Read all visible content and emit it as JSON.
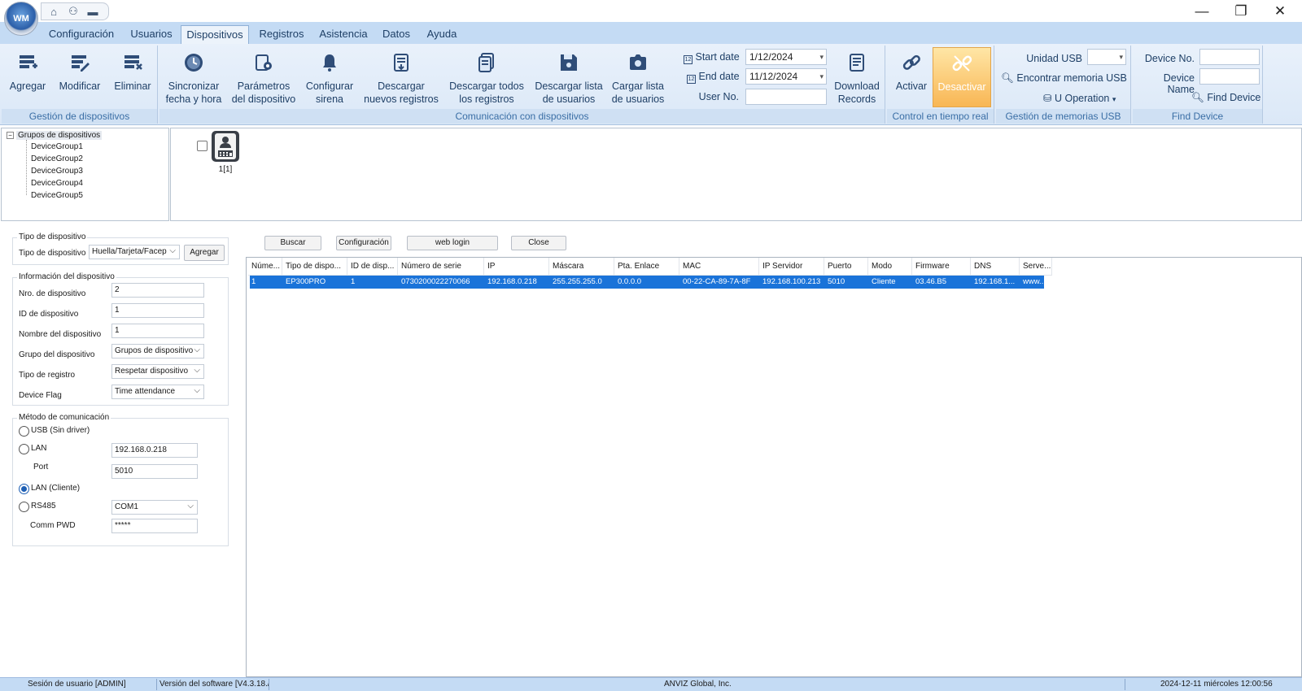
{
  "window": {
    "minimize": "—",
    "restore": "❐",
    "close": "✕"
  },
  "menu_tabs": [
    "Configuración",
    "Usuarios",
    "Dispositivos",
    "Registros",
    "Asistencia",
    "Datos",
    "Ayuda"
  ],
  "active_tab": "Dispositivos",
  "ribbon": {
    "gestion": {
      "label": "Gestión de dispositivos",
      "agregar": "Agregar",
      "modificar": "Modificar",
      "eliminar": "Eliminar"
    },
    "comunicacion": {
      "label": "Comunicación con dispositivos",
      "sync_l1": "Sincronizar",
      "sync_l2": "fecha y hora",
      "param_l1": "Parámetros",
      "param_l2": "del dispositivo",
      "sirena_l1": "Configurar",
      "sirena_l2": "sirena",
      "desc_nuevos_l1": "Descargar",
      "desc_nuevos_l2": "nuevos registros",
      "desc_todos_l1": "Descargar todos",
      "desc_todos_l2": "los registros",
      "desc_lista_l1": "Descargar lista",
      "desc_lista_l2": "de usuarios",
      "cargar_l1": "Cargar lista",
      "cargar_l2": "de usuarios",
      "start_date_label": "Start date",
      "start_date_value": "1/12/2024",
      "end_date_label": "End date",
      "end_date_value": "11/12/2024",
      "user_no_label": "User No.",
      "download_l1": "Download",
      "download_l2": "Records"
    },
    "control": {
      "label": "Control en tiempo real",
      "activar": "Activar",
      "desactivar": "Desactivar"
    },
    "usb": {
      "label": "Gestión de memorias USB",
      "unidad": "Unidad USB",
      "encontrar": "Encontrar memoria USB",
      "u_operation": "U Operation"
    },
    "find": {
      "label": "Find Device",
      "device_no": "Device No.",
      "device_name": "Device Name",
      "find_button": "Find Device"
    }
  },
  "tree": {
    "root": "Grupos de dispositivos",
    "items": [
      "DeviceGroup1",
      "DeviceGroup2",
      "DeviceGroup3",
      "DeviceGroup4",
      "DeviceGroup5"
    ]
  },
  "device_tile": {
    "label": "1[1]"
  },
  "form": {
    "tipo_title": "Tipo de dispositivo",
    "tipo_label": "Tipo de dispositivo",
    "tipo_value": "Huella/Tarjeta/Facep",
    "agregar": "Agregar",
    "info_title": "Información del dispositivo",
    "nro_label": "Nro. de dispositivo",
    "nro_value": "2",
    "id_label": "ID de dispositivo",
    "id_value": "1",
    "nombre_label": "Nombre del dispositivo",
    "nombre_value": "1",
    "grupo_label": "Grupo del dispositivo",
    "grupo_value": "Grupos de dispositivo",
    "registro_label": "Tipo de registro",
    "registro_value": "Respetar dispositivo",
    "flag_label": "Device Flag",
    "flag_value": "Time attendance",
    "metodo_title": "Método de comunicación",
    "usb_label": "USB (Sin driver)",
    "lan_label": "LAN",
    "lan_value": "192.168.0.218",
    "port_label": "Port",
    "port_value": "5010",
    "lan_cliente_label": "LAN (Cliente)",
    "rs485_label": "RS485",
    "rs485_value": "COM1",
    "pwd_label": "Comm PWD",
    "pwd_value": "*****",
    "selected_method": "LAN (Cliente)"
  },
  "actions": {
    "buscar": "Buscar",
    "configuracion": "Configuración",
    "web_login": "web login",
    "close": "Close"
  },
  "table": {
    "columns": [
      "Núme...",
      "Tipo de dispo...",
      "ID de disp...",
      "Número de serie",
      "IP",
      "Máscara",
      "Pta. Enlace",
      "MAC",
      "IP Servidor",
      "Puerto",
      "Modo",
      "Firmware",
      "DNS",
      "Serve..."
    ],
    "rows": [
      [
        "1",
        "EP300PRO",
        "1",
        "0730200022270066",
        "192.168.0.218",
        "255.255.255.0",
        "0.0.0.0",
        "00-22-CA-89-7A-8F",
        "192.168.100.213",
        "5010",
        "Cliente",
        "03.46.B5",
        "192.168.1...",
        "www..."
      ]
    ]
  },
  "status": {
    "sesion": "Sesión de usuario  [ADMIN]",
    "version": "Versión del software  [V4.3.18./",
    "company": "ANVIZ Global, Inc.",
    "datetime": "2024-12-11 miércoles 12:00:56"
  },
  "colors": {
    "ribbon_bg": "#dbe8f7",
    "tab_bg": "#c4dbf4",
    "selection": "#1a73d9",
    "highlight_button": "#f8b654"
  }
}
